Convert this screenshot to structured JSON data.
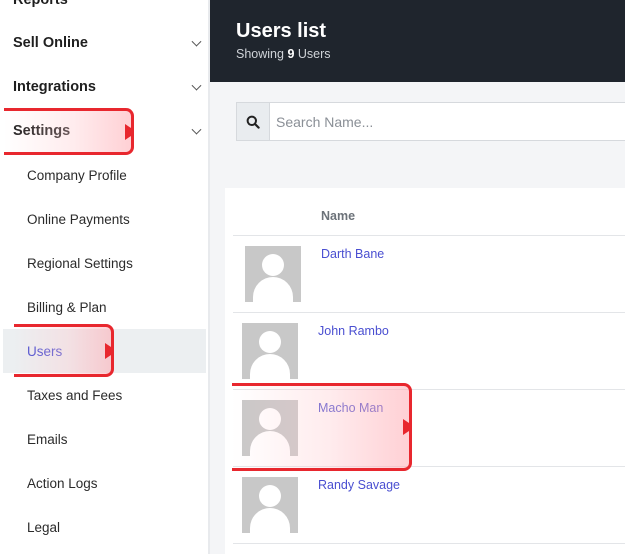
{
  "sidebar": {
    "sections": [
      {
        "label": "Reports"
      },
      {
        "label": "Sell Online"
      },
      {
        "label": "Integrations"
      },
      {
        "label": "Settings"
      }
    ],
    "items": [
      {
        "label": "Company Profile"
      },
      {
        "label": "Online Payments"
      },
      {
        "label": "Regional Settings"
      },
      {
        "label": "Billing & Plan"
      },
      {
        "label": "Users"
      },
      {
        "label": "Taxes and Fees"
      },
      {
        "label": "Emails"
      },
      {
        "label": "Action Logs"
      },
      {
        "label": "Legal"
      }
    ],
    "active_item": "Users"
  },
  "header": {
    "title": "Users list",
    "subtitle_prefix": "Showing ",
    "count": "9",
    "subtitle_suffix": " Users"
  },
  "search": {
    "placeholder": "Search Name...",
    "value": "",
    "icon": "search-icon"
  },
  "table": {
    "columns": [
      "Name"
    ],
    "rows": [
      {
        "name": "Darth Bane"
      },
      {
        "name": "John Rambo"
      },
      {
        "name": "Macho Man"
      },
      {
        "name": "Randy Savage"
      }
    ]
  },
  "colors": {
    "header_bg": "#1f252d",
    "link": "#4a4fd1",
    "highlight": "#e8272e",
    "active_bg": "#eceff1"
  }
}
